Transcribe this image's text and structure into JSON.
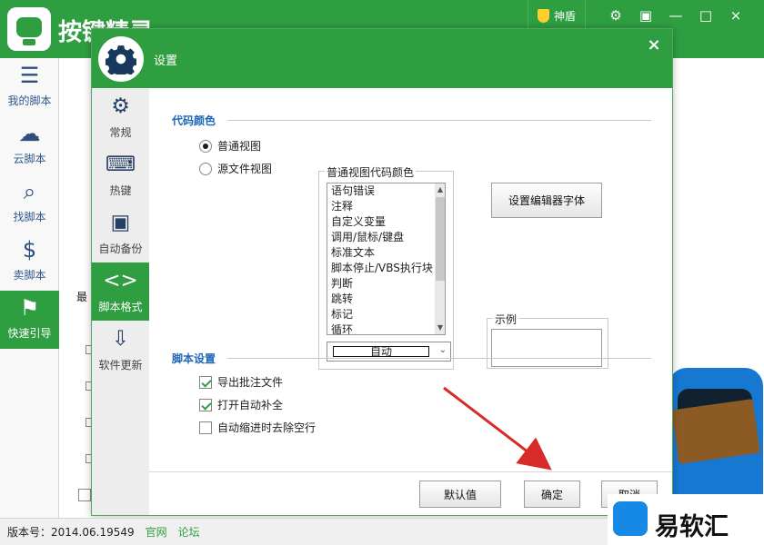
{
  "app": {
    "name": "按键精灵",
    "tool_label": "神盾",
    "version_label": "版本号：2014.06.19549",
    "links": [
      "官网",
      "论坛"
    ]
  },
  "sidebar": {
    "items": [
      {
        "label": "我的脚本",
        "icon": "list-icon"
      },
      {
        "label": "云脚本",
        "icon": "cloud-icon"
      },
      {
        "label": "找脚本",
        "icon": "search-icon"
      },
      {
        "label": "卖脚本",
        "icon": "dollar-icon"
      },
      {
        "label": "快速引导",
        "icon": "signpost-icon"
      }
    ]
  },
  "dialog": {
    "title": "设置",
    "close": "×",
    "tabs": [
      {
        "label": "常规",
        "icon": "gear-icon"
      },
      {
        "label": "热键",
        "icon": "keyboard-icon"
      },
      {
        "label": "自动备份",
        "icon": "save-icon"
      },
      {
        "label": "脚本格式",
        "icon": "code-icon"
      },
      {
        "label": "软件更新",
        "icon": "update-icon"
      }
    ],
    "code_color": {
      "section_title": "代码颜色",
      "radio_normal": "普通视图",
      "radio_source": "源文件视图",
      "list_title": "普通视图代码颜色",
      "list_items": [
        "语句错误",
        "注释",
        "自定义变量",
        "调用/鼠标/键盘",
        "标准文本",
        "脚本停止/VBS执行块",
        "判断",
        "跳转",
        "标记",
        "循环"
      ],
      "combo_value": "自动",
      "font_button": "设置编辑器字体",
      "example_label": "示例"
    },
    "script_settings": {
      "section_title": "脚本设置",
      "checks": [
        {
          "label": "导出批注文件",
          "checked": true
        },
        {
          "label": "打开自动补全",
          "checked": true
        },
        {
          "label": "自动缩进时去除空行",
          "checked": false
        }
      ]
    },
    "buttons": {
      "default": "默认值",
      "ok": "确定",
      "cancel": "取消"
    }
  },
  "overlay": {
    "watermark": "易软汇",
    "behind_label": "最",
    "arrow_color": "#d92a2a"
  }
}
